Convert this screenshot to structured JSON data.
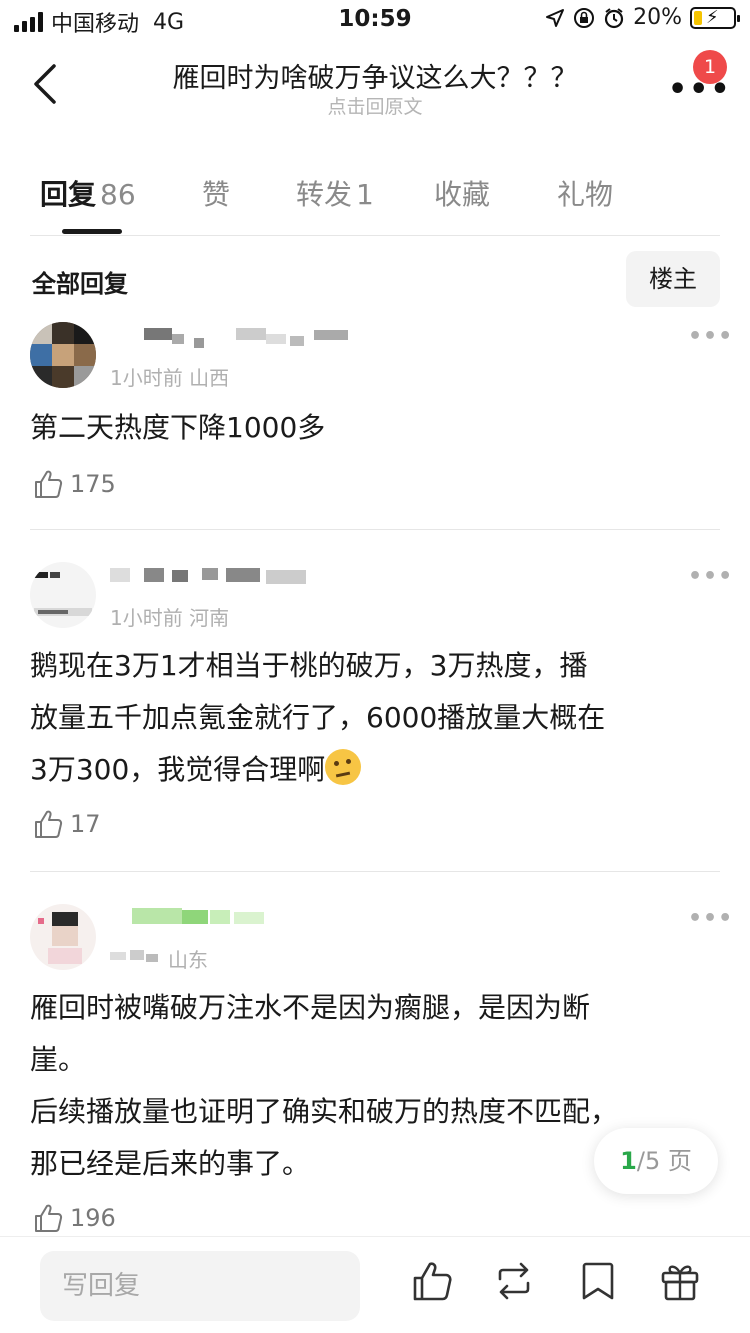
{
  "status_bar": {
    "carrier": "中国移动",
    "network": "4G",
    "time": "10:59",
    "battery": "20%",
    "battery_level": 0.2
  },
  "header": {
    "title": "雁回时为啥破万争议这么大？？？",
    "subtitle": "点击回原文",
    "notification_count": "1"
  },
  "tabs": [
    {
      "label": "回复",
      "count": "86"
    },
    {
      "label": "赞",
      "count": ""
    },
    {
      "label": "转发",
      "count": "1"
    },
    {
      "label": "收藏",
      "count": ""
    },
    {
      "label": "礼物",
      "count": ""
    }
  ],
  "section": {
    "title": "全部回复",
    "filter_label": "楼主"
  },
  "comments": [
    {
      "meta": "1小时前 山西",
      "lines": [
        "第二天热度下降1000多"
      ],
      "likes": "175"
    },
    {
      "meta": "1小时前 河南",
      "lines": [
        "鹅现在3万1才相当于桃的破万，3万热度，播",
        "放量五千加点氪金就行了，6000播放量大概在",
        "3万300，我觉得合理啊"
      ],
      "likes": "17"
    },
    {
      "meta": "山东",
      "lines": [
        "雁回时被嘴破万注水不是因为瘸腿，是因为断",
        "崖。",
        "后续播放量也证明了确实和破万的热度不匹配，",
        "那已经是后来的事了。"
      ],
      "likes": "196"
    }
  ],
  "pager": {
    "current": "1",
    "total": "/5 页"
  },
  "bottom_bar": {
    "reply_placeholder": "写回复"
  },
  "colors": {
    "accent_green": "#2aa84a",
    "badge_red": "#ef4a4a",
    "divider": "#e6e6e6"
  }
}
